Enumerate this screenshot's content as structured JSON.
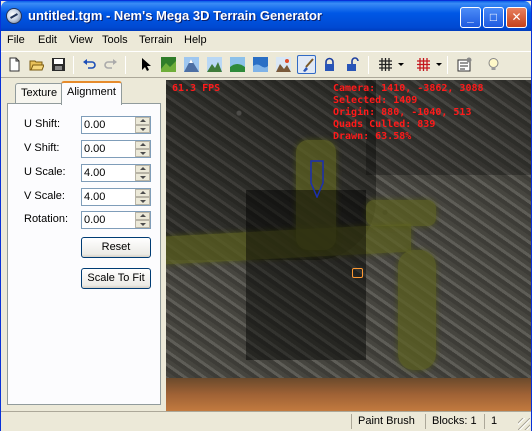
{
  "window": {
    "title": "untitled.tgm - Nem's Mega 3D Terrain Generator",
    "minimize_glyph": "_",
    "maximize_glyph": "□",
    "close_glyph": "✕"
  },
  "menu": {
    "items": [
      {
        "label": "File"
      },
      {
        "label": "Edit"
      },
      {
        "label": "View"
      },
      {
        "label": "Tools"
      },
      {
        "label": "Terrain"
      },
      {
        "label": "Help"
      }
    ]
  },
  "toolbar": {
    "tools": [
      {
        "name": "new-file-icon"
      },
      {
        "name": "open-folder-icon"
      },
      {
        "name": "save-disk-icon"
      },
      {
        "name": "undo-icon"
      },
      {
        "name": "redo-icon"
      },
      {
        "name": "select-arrow-icon"
      },
      {
        "name": "terrain-tool-1-icon"
      },
      {
        "name": "terrain-tool-2-icon"
      },
      {
        "name": "terrain-tool-3-icon"
      },
      {
        "name": "terrain-tool-4-icon"
      },
      {
        "name": "terrain-tool-5-icon"
      },
      {
        "name": "terrain-tool-6-icon"
      },
      {
        "name": "paint-brush-icon"
      },
      {
        "name": "lock-icon"
      },
      {
        "name": "unlock-icon"
      },
      {
        "name": "grid-icon"
      },
      {
        "name": "grid-red-icon"
      },
      {
        "name": "properties-icon"
      },
      {
        "name": "lightbulb-icon"
      }
    ],
    "active_tool": "paint-brush-icon"
  },
  "tabs": [
    {
      "label": "Texture",
      "selected": false
    },
    {
      "label": "Alignment",
      "selected": true
    }
  ],
  "alignment": {
    "fields": [
      {
        "label": "U Shift:",
        "value": "0.00"
      },
      {
        "label": "V Shift:",
        "value": "0.00"
      },
      {
        "label": "U Scale:",
        "value": "4.00"
      },
      {
        "label": "V Scale:",
        "value": "4.00"
      },
      {
        "label": "Rotation:",
        "value": "0.00"
      }
    ],
    "reset_label": "Reset",
    "scale_to_fit_label": "Scale To Fit"
  },
  "viewport": {
    "fps": "61.3 FPS",
    "hud": [
      "Camera: 1410, -3862, 3088",
      "Selected: 1409",
      "Origin: 880, -1040, 513",
      "Quads Culled: 839",
      "Drawn: 63.58%"
    ]
  },
  "status": {
    "tool": "Paint Brush",
    "blocks": "Blocks: 1",
    "count": "1"
  },
  "colors": {
    "titlebar": "#0058e6",
    "hud_text": "#ff1a1a",
    "tab_highlight": "#e68b2c"
  }
}
